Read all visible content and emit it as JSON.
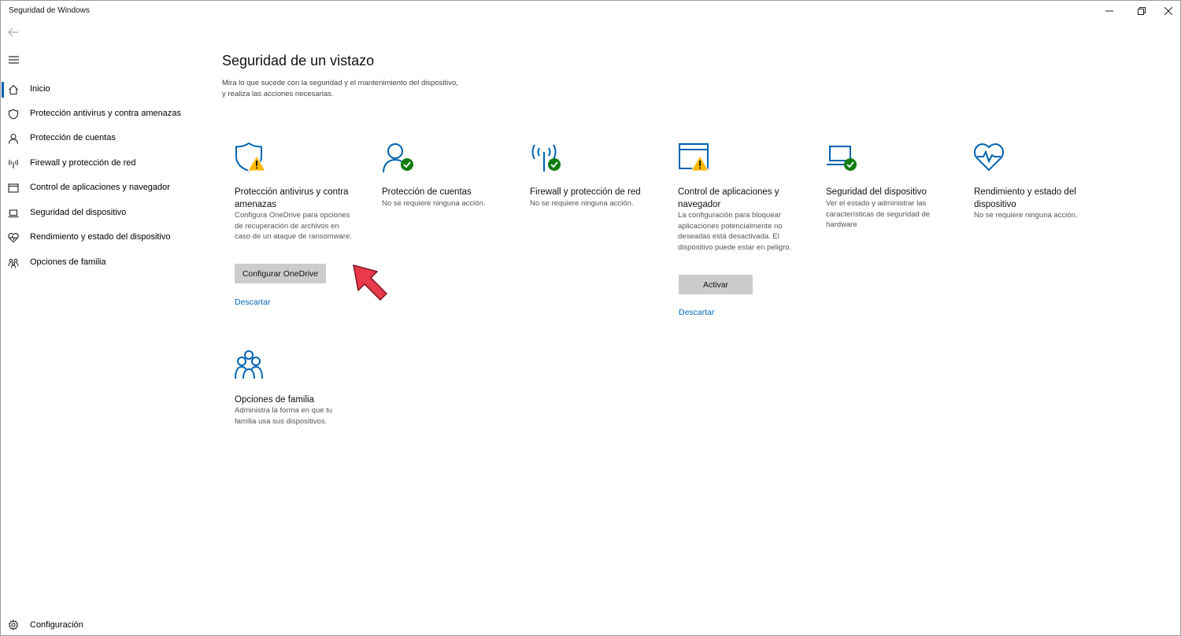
{
  "window": {
    "title": "Seguridad de Windows"
  },
  "sidebar": {
    "items": [
      {
        "label": "Inicio",
        "icon": "home-icon"
      },
      {
        "label": "Protección antivirus y contra amenazas",
        "icon": "shield-icon"
      },
      {
        "label": "Protección de cuentas",
        "icon": "person-icon"
      },
      {
        "label": "Firewall y protección de red",
        "icon": "antenna-icon"
      },
      {
        "label": "Control de aplicaciones y navegador",
        "icon": "browser-window-icon"
      },
      {
        "label": "Seguridad del dispositivo",
        "icon": "laptop-icon"
      },
      {
        "label": "Rendimiento y estado del dispositivo",
        "icon": "heart-pulse-icon"
      },
      {
        "label": "Opciones de familia",
        "icon": "family-icon"
      }
    ],
    "selected_index": 0,
    "settings_label": "Configuración"
  },
  "main": {
    "title": "Seguridad de un vistazo",
    "description": "Mira lo que sucede con la seguridad y el mantenimiento del dispositivo, y realiza las acciones necesarias.",
    "cards": [
      {
        "title": "Protección antivirus y contra amenazas",
        "description": "Configura OneDrive para opciones de recuperación de archivos en caso de un ataque de ransomware.",
        "status": "warning",
        "button": "Configurar OneDrive",
        "link": "Descartar"
      },
      {
        "title": "Protección de cuentas",
        "description": "No se requiere ninguna acción.",
        "status": "ok"
      },
      {
        "title": "Firewall y protección de red",
        "description": "No se requiere ninguna acción.",
        "status": "ok"
      },
      {
        "title": "Control de aplicaciones y navegador",
        "description": "La configuración para bloquear aplicaciones potencialmente no deseadas está desactivada. El dispositivo puede estar en peligro.",
        "status": "warning",
        "button": "Activar",
        "link": "Descartar"
      },
      {
        "title": "Seguridad del dispositivo",
        "description": "Ver el estado y administrar las características de seguridad de hardware",
        "status": "ok"
      },
      {
        "title": "Rendimiento y estado del dispositivo",
        "description": "No se requiere ninguna acción.",
        "status": "none"
      },
      {
        "title": "Opciones de familia",
        "description": "Administra la forma en que tu familia usa sus dispositivos.",
        "status": "none"
      }
    ]
  },
  "colors": {
    "accent": "#0063b1",
    "link": "#0067b8",
    "ok": "#107c10",
    "warning": "#ffb900",
    "button_bg": "#cccccc",
    "annotation_arrow": "#e83a4a"
  }
}
